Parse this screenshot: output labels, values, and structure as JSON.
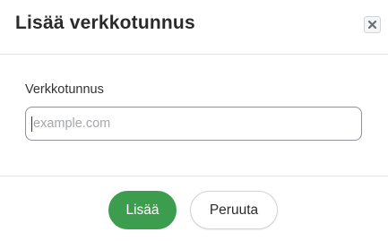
{
  "dialog": {
    "title": "Lisää verkkotunnus",
    "close_icon": "close-icon"
  },
  "form": {
    "label": "Verkkotunnus",
    "input_value": "",
    "input_placeholder": "example.com"
  },
  "footer": {
    "primary_label": "Lisää",
    "secondary_label": "Peruuta"
  },
  "colors": {
    "primary": "#3d9d4f",
    "border": "#8f9296",
    "divider": "#e3e5e8"
  }
}
